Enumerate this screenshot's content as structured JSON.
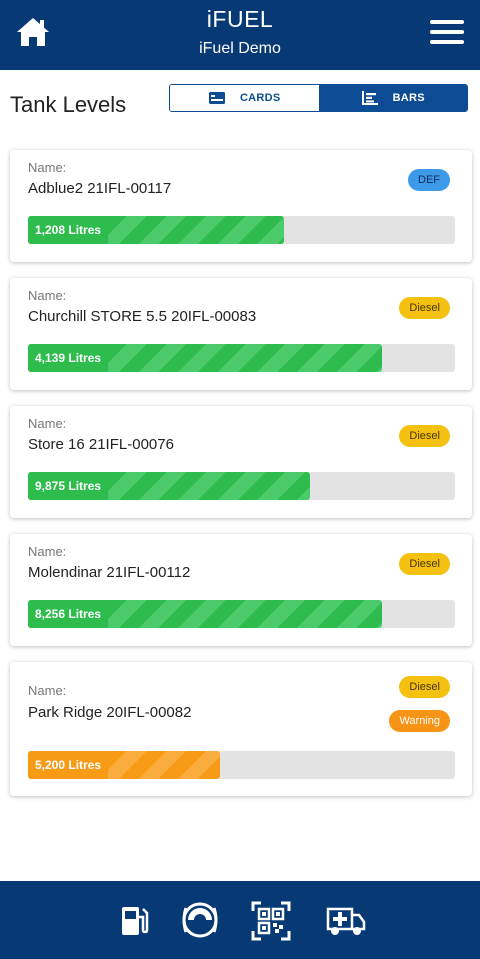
{
  "header": {
    "title": "iFUEL",
    "subtitle": "iFuel Demo",
    "home_icon": "home-icon",
    "menu_icon": "hamburger-menu-icon"
  },
  "main": {
    "title": "Tank Levels",
    "view_toggle": {
      "cards_label": "CARDS",
      "bars_label": "BARS",
      "selected": "BARS"
    },
    "name_label": "Name:",
    "tanks": [
      {
        "name": "Adblue2 21IFL-00117",
        "fuel": "DEF",
        "level_text": "1,208 Litres",
        "fill_fraction": 0.6,
        "color": "green"
      },
      {
        "name": "Churchill STORE 5.5 20IFL-00083",
        "fuel": "Diesel",
        "level_text": "4,139 Litres",
        "fill_fraction": 0.83,
        "color": "green"
      },
      {
        "name": "Store 16 21IFL-00076",
        "fuel": "Diesel",
        "level_text": "9,875 Litres",
        "fill_fraction": 0.66,
        "color": "green"
      },
      {
        "name": "Molendinar 21IFL-00112",
        "fuel": "Diesel",
        "level_text": "8,256 Litres",
        "fill_fraction": 0.83,
        "color": "green"
      },
      {
        "name": "Park Ridge 20IFL-00082",
        "fuel": "Diesel",
        "status": "Warning",
        "level_text": "5,200 Litres",
        "fill_fraction": 0.45,
        "color": "orange"
      }
    ]
  },
  "bottom_nav": {
    "items": [
      "fuel-pump-icon",
      "gauge-icon",
      "qr-code-icon",
      "ambulance-icon"
    ]
  },
  "colors": {
    "header_bg": "#073a75",
    "accent": "#0d4c94",
    "bar_green": "#2ebd4d",
    "bar_orange": "#f79a16",
    "badge_def": "#3d9ae8",
    "badge_diesel": "#f4c110",
    "badge_warning": "#f79416"
  }
}
